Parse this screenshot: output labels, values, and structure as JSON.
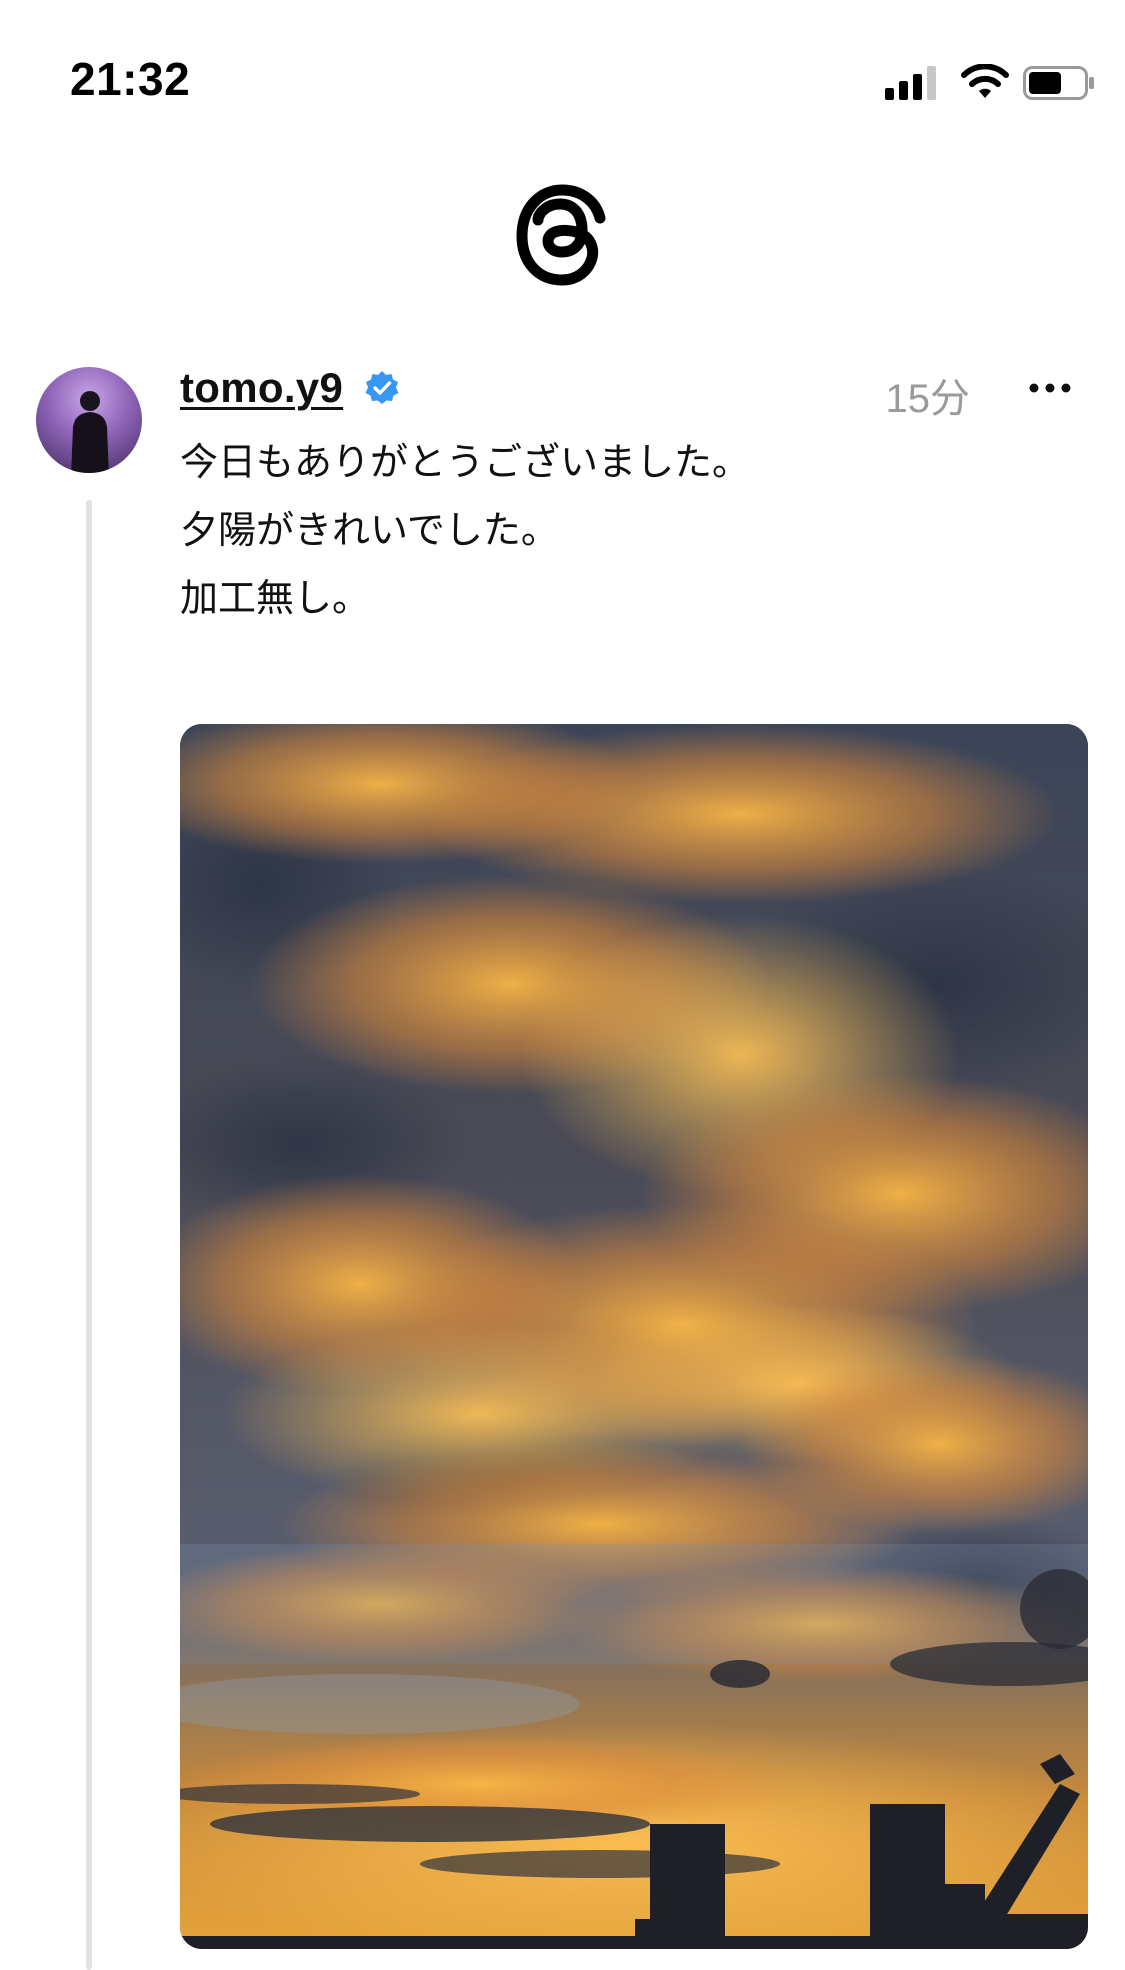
{
  "status_bar": {
    "time": "21:32",
    "icons": [
      "signal-icon",
      "wifi-icon",
      "battery-icon"
    ],
    "battery_level": 0.6
  },
  "header": {
    "logo_icon": "threads-logo-icon"
  },
  "post": {
    "username": "tomo.y9",
    "verified": true,
    "timestamp": "15分",
    "text_lines": [
      "今日もありがとうございました。",
      "夕陽がきれいでした。",
      "",
      "加工無し。"
    ],
    "image": {
      "subject": "sunset sky with orange clouds and city silhouette"
    }
  },
  "colors": {
    "verified_blue": "#3897f0",
    "timestamp_gray": "#9a9a9a",
    "thread_line": "#e2e2e2",
    "text": "#111111"
  }
}
